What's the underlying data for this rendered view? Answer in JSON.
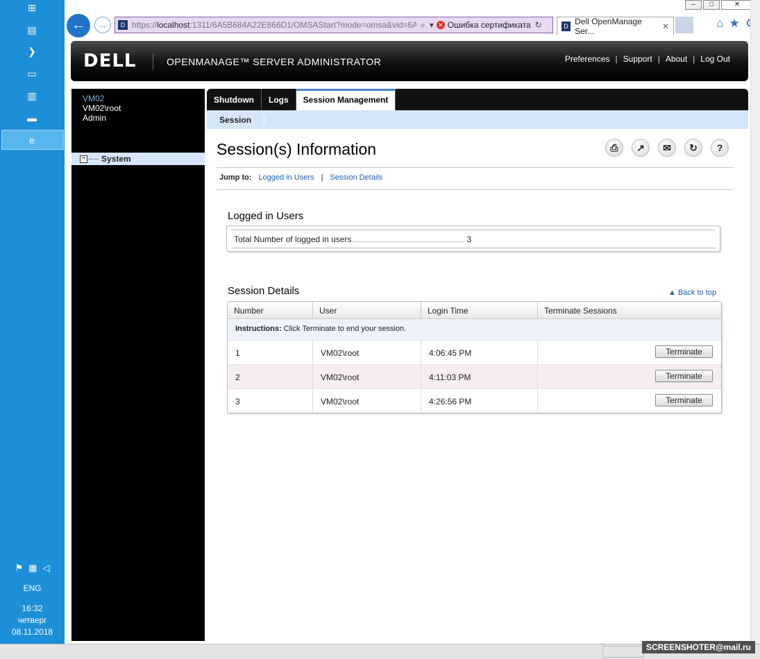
{
  "taskbar": {
    "icons": [
      "windows-start-icon",
      "server-manager-icon",
      "powershell-icon",
      "file-explorer-icon",
      "network-icon",
      "cmd-icon",
      "internet-explorer-icon"
    ],
    "tray_language": "ENG",
    "clock_time": "16:32",
    "clock_day": "четверг",
    "clock_date": "08.11.2018"
  },
  "browser": {
    "url_prefix": "https://",
    "url_host": "localhost",
    "url_rest": ":1311/6A5B684A22E866D1/OMSAStart?mode=omsa&vid=6A",
    "cert_error": "Ошибка сертификата",
    "tab_title": "Dell OpenManage Ser..."
  },
  "header": {
    "logo": "DELL",
    "title": "OPENMANAGE™ SERVER ADMINISTRATOR",
    "links": [
      "Preferences",
      "Support",
      "About",
      "Log Out"
    ]
  },
  "sidebar": {
    "host": "VM02",
    "user": "VM02\\root",
    "role": "Admin",
    "tree_item": "System"
  },
  "tabs": {
    "items": [
      "Shutdown",
      "Logs",
      "Session Management"
    ],
    "active": "Session Management",
    "subtab": "Session"
  },
  "main": {
    "title": "Session(s) Information",
    "jump_label": "Jump to:",
    "jump_links": [
      "Logged in Users",
      "Session Details"
    ],
    "logged_users_title": "Logged in Users",
    "total_label": "Total Number of logged in users",
    "total_value": "3",
    "details_title": "Session Details",
    "back_to_top": "Back to top",
    "columns": [
      "Number",
      "User",
      "Login Time",
      "Terminate Sessions"
    ],
    "instructions_bold": "Instructions:",
    "instructions_text": " Click Terminate to end your session.",
    "rows": [
      {
        "number": "1",
        "user": "VM02\\root",
        "time": "4:06:45 PM",
        "action": "Terminate"
      },
      {
        "number": "2",
        "user": "VM02\\root",
        "time": "4:11:03 PM",
        "action": "Terminate"
      },
      {
        "number": "3",
        "user": "VM02\\root",
        "time": "4:26:56 PM",
        "action": "Terminate"
      }
    ]
  },
  "watermark": "SCREENSHOTER@mail.ru"
}
